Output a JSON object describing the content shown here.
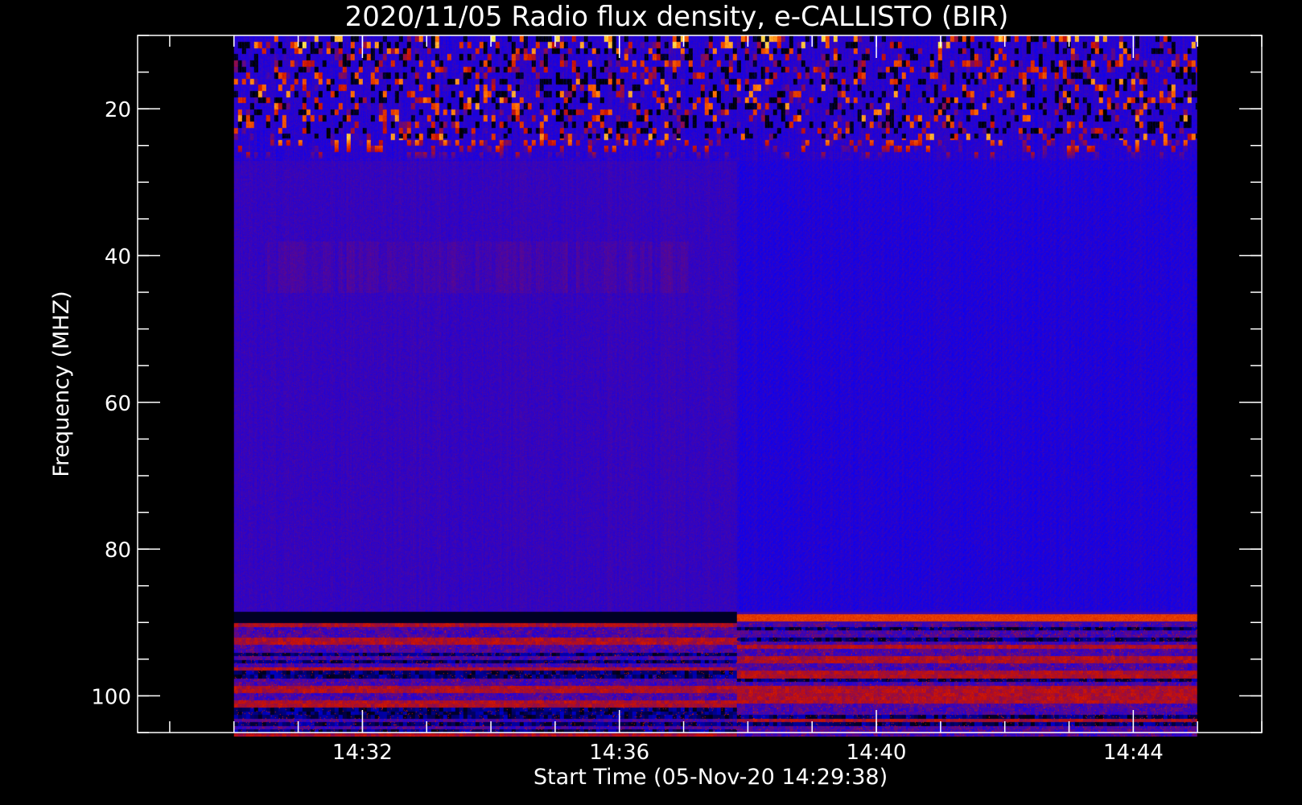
{
  "chart_data": {
    "type": "heatmap",
    "title": "2020/11/05  Radio flux density, e-CALLISTO (BIR)",
    "xlabel": "Start Time (05-Nov-20 14:29:38)",
    "ylabel": "Frequency (MHZ)",
    "x_unit": "time",
    "x_range": [
      "14:30:00",
      "14:45:00"
    ],
    "xlim": [
      "14:28:30",
      "14:46:00"
    ],
    "y_range": [
      10,
      105.5
    ],
    "ylim": [
      105,
      10
    ],
    "y_inverted": true,
    "x_major_ticks": [
      {
        "value": "14:32",
        "label": "14:32"
      },
      {
        "value": "14:36",
        "label": "14:36"
      },
      {
        "value": "14:40",
        "label": "14:40"
      },
      {
        "value": "14:44",
        "label": "14:44"
      }
    ],
    "x_minor_tick_interval_minutes": 1,
    "y_major_ticks": [
      {
        "value": 20,
        "label": "20"
      },
      {
        "value": 40,
        "label": "40"
      },
      {
        "value": 60,
        "label": "60"
      },
      {
        "value": 80,
        "label": "80"
      },
      {
        "value": 100,
        "label": "100"
      }
    ],
    "y_minor_tick_interval": 5,
    "colormap": [
      "#000000",
      "#0000ff",
      "#cc1100",
      "#ff6a00",
      "#ffff66"
    ],
    "background_color": "#000000",
    "frame_color": "#ffffff",
    "segment_change_time": "14:37:50",
    "features": [
      {
        "band": "interference",
        "f_min": 10,
        "f_max": 27,
        "t_start": "14:30:00",
        "t_end": "14:45:00",
        "level": "high"
      },
      {
        "band": "quiet background",
        "f_min": 27,
        "f_max": 88.5,
        "t_start": "14:30:00",
        "t_end": "14:45:00",
        "level": "low"
      },
      {
        "band": "dark line",
        "f_min": 88.5,
        "f_max": 90,
        "t_start": "14:30:00",
        "t_end": "14:37:50",
        "level": "none"
      },
      {
        "band": "red line",
        "f_min": 88.8,
        "f_max": 89.8,
        "t_start": "14:37:50",
        "t_end": "14:45:00",
        "level": "medium"
      },
      {
        "band": "striped",
        "f_min": 90,
        "f_max": 105.5,
        "t_start": "14:30:00",
        "t_end": "14:45:00",
        "level": "medium"
      }
    ]
  }
}
